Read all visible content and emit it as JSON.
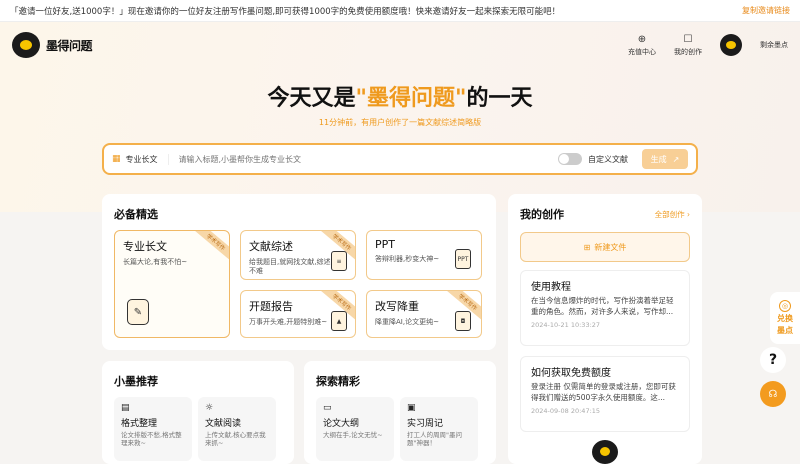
{
  "banner": {
    "text": "「邀请一位好友,送1000字！」现在邀请你的一位好友注册写作墨问题,即可获得1000字的免费使用额度哦！快来邀请好友一起来探索无限可能吧！",
    "copy_link": "复制邀请链接"
  },
  "header": {
    "recharge_label": "充值中心",
    "my_works_label": "我的创作",
    "balance_label": "剩余墨点",
    "logo_text": "墨得问题"
  },
  "hero": {
    "title_prefix": "今天又是",
    "title_accent": "\"墨得问题\"",
    "title_suffix": "的一天",
    "subtitle": "11分钟前，有用户创作了一篇文献综述简略版"
  },
  "search": {
    "type_label": "专业长文",
    "placeholder": "请输入标题,小墨帮你生成专业长文",
    "custom_doc_label": "自定义文献",
    "generate_label": "生成"
  },
  "featured": {
    "title": "必备精选",
    "tools": [
      {
        "title": "专业长文",
        "desc": "长篇大论,有我不怕~",
        "ribbon": "学术写作"
      },
      {
        "title": "文献综述",
        "desc": "给我题目,就网找文献,综述不难",
        "ribbon": "学术写作"
      },
      {
        "title": "PPT",
        "desc": "答辩利器,秒变大神~",
        "ribbon": "",
        "icon": "PPT"
      },
      {
        "title": "开题报告",
        "desc": "万事开头难,开题特别难~",
        "ribbon": "学术写作"
      },
      {
        "title": "改写降重",
        "desc": "降重降AI,论文更纯~",
        "ribbon": "学术写作"
      }
    ]
  },
  "mine": {
    "title": "我的创作",
    "all_label": "全部创作",
    "new_label": "新建文件",
    "docs": [
      {
        "title": "使用教程",
        "body": "在当今信息爆炸的时代，写作扮演着举足轻重的角色。然而，对许多人来说，写作却...",
        "date": "2024-10-21 10:33:27"
      },
      {
        "title": "如何获取免费额度",
        "body": "登录注册 仅需简单的登录或注册，您即可获得我们赠送的500字永久使用额度。这...",
        "date": "2024-09-08 20:47:15"
      }
    ]
  },
  "recommend": {
    "title": "小墨推荐",
    "items": [
      {
        "title": "格式整理",
        "desc": "论文排版不愁,格式整理来救~"
      },
      {
        "title": "文献阅读",
        "desc": "上传文献,核心要点我来抓~"
      }
    ]
  },
  "explore": {
    "title": "探索精彩",
    "items": [
      {
        "title": "论文大纲",
        "desc": "大纲在手,论文无忧~"
      },
      {
        "title": "实习周记",
        "desc": "打工人的周周\"墨问题\"神器！"
      }
    ]
  },
  "floater": {
    "line1": "兑换",
    "line2": "墨点"
  },
  "help_label": "?",
  "colors": {
    "accent": "#ef9a1e",
    "border": "#f2c98a"
  }
}
